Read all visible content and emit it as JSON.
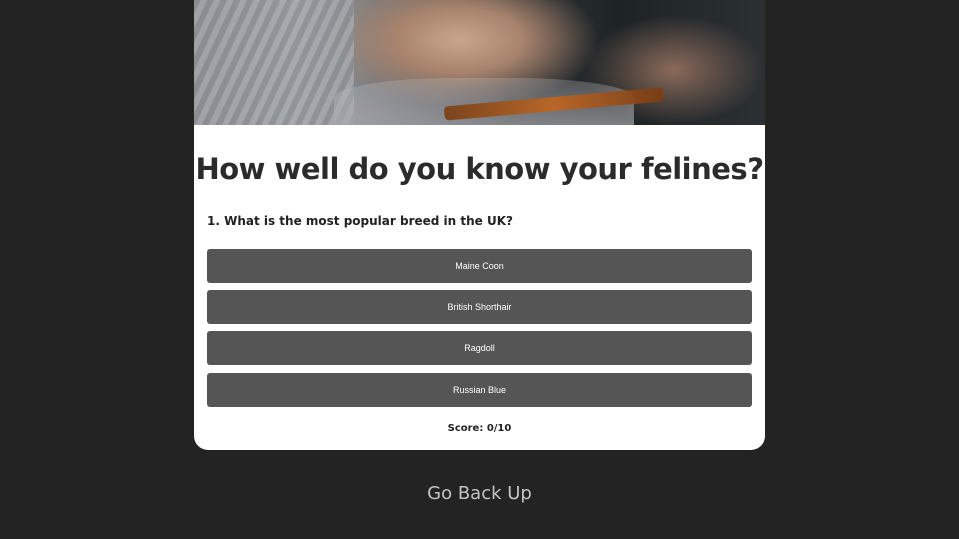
{
  "quiz": {
    "hero_image": "person-holding-phone-photo",
    "title": "How well do you know your felines?",
    "question": "1. What is the most popular breed in the UK?",
    "answers": [
      "Maine Coon",
      "British Shorthair",
      "Ragdoll",
      "Russian Blue"
    ],
    "score": "Score: 0/10"
  },
  "footer": {
    "back_link": "Go Back Up"
  },
  "colors": {
    "page_background": "#232323",
    "card_background": "#ffffff",
    "answer_button": "#555555",
    "back_link_text": "#c4c4c4"
  }
}
